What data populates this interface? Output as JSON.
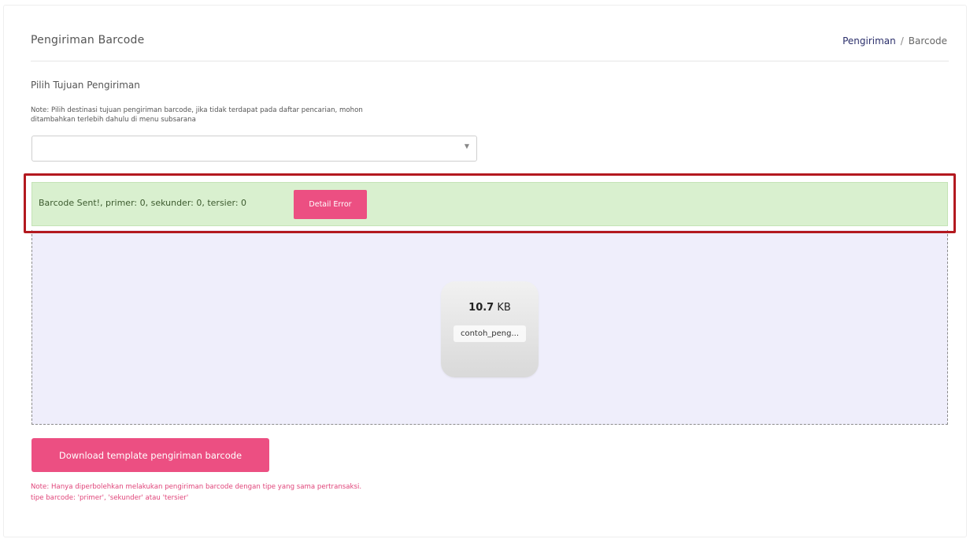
{
  "header": {
    "title": "Pengiriman Barcode",
    "breadcrumb": {
      "parent": "Pengiriman",
      "separator": "/",
      "current": "Barcode"
    }
  },
  "destination": {
    "label": "Pilih Tujuan Pengiriman",
    "note_line1": "Note: Pilih destinasi tujuan pengiriman barcode, jika tidak terdapat pada daftar pencarian, mohon",
    "note_line2": "ditambahkan terlebih dahulu di menu subsarana",
    "selected_value": "",
    "caret_icon": "chevron-down-icon"
  },
  "alert": {
    "message": "Barcode Sent!, primer: 0, sekunder: 0, tersier: 0",
    "button_label": "Detail Error",
    "background_color": "#d9f0cf",
    "highlight_color": "#b3191f"
  },
  "upload": {
    "file_size_value": "10.7",
    "file_size_unit": "KB",
    "file_name": "contoh_peng..."
  },
  "download": {
    "button_label": "Download template pengiriman barcode",
    "note_line1": "Note: Hanya diperbolehkan melakukan pengiriman barcode dengan tipe yang sama pertransaksi.",
    "note_line2": "tipe barcode: 'primer', 'sekunder' atau 'tersier'"
  },
  "colors": {
    "accent": "#ec4f82",
    "note_text": "#e0457a",
    "dropzone_bg": "#efeefb"
  }
}
